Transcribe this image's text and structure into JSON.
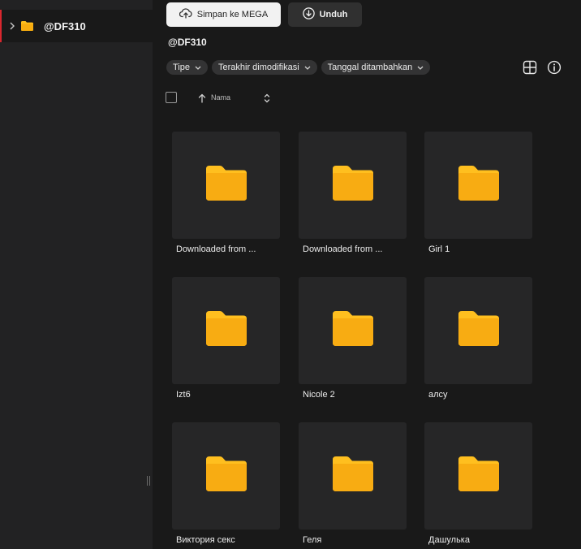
{
  "sidebar": {
    "tree": [
      {
        "label": "@DF310",
        "icon": "folder-icon",
        "expanded": false,
        "selected": true
      }
    ]
  },
  "toolbar": {
    "save_to_mega_label": "Simpan ke MEGA",
    "download_label": "Unduh"
  },
  "breadcrumb": {
    "current": "@DF310"
  },
  "filters": [
    {
      "label": "Tipe"
    },
    {
      "label": "Terakhir dimodifikasi"
    },
    {
      "label": "Tanggal ditambahkan"
    }
  ],
  "list_header": {
    "name_column": "Nama"
  },
  "colors": {
    "accent_red": "#d9272e",
    "folder_yellow": "#ffbf1f",
    "folder_yellow_dark": "#f2a500",
    "background": "#191919",
    "sidebar_background": "#222223",
    "card_background": "#262627"
  },
  "items": [
    {
      "name": "Downloaded from ...",
      "type": "folder"
    },
    {
      "name": "Downloaded from ...",
      "type": "folder"
    },
    {
      "name": "Girl 1",
      "type": "folder"
    },
    {
      "name": "Izt6",
      "type": "folder"
    },
    {
      "name": "Nicole 2",
      "type": "folder"
    },
    {
      "name": "алсу",
      "type": "folder"
    },
    {
      "name": "Виктория секс",
      "type": "folder"
    },
    {
      "name": "Геля",
      "type": "folder"
    },
    {
      "name": "Дашулька",
      "type": "folder"
    }
  ]
}
